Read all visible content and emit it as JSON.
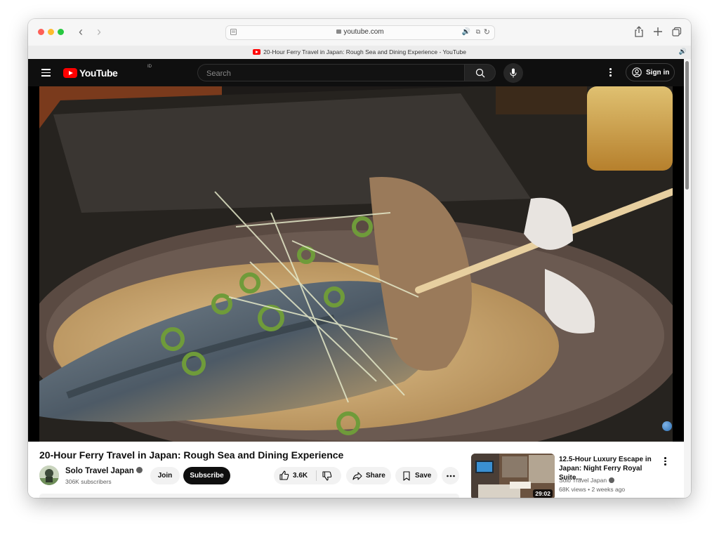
{
  "browser": {
    "url": "youtube.com",
    "tab_title": "20-Hour Ferry Travel in Japan: Rough Sea and Dining Experience - YouTube"
  },
  "masthead": {
    "logo_text": "YouTube",
    "country_code": "ID",
    "search_placeholder": "Search",
    "sign_in_label": "Sign in"
  },
  "video": {
    "title": "20-Hour Ferry Travel in Japan: Rough Sea and Dining Experience",
    "channel": "Solo Travel Japan",
    "subscribers": "306K subscribers",
    "join_label": "Join",
    "subscribe_label": "Subscribe",
    "likes": "3.6K",
    "share_label": "Share",
    "save_label": "Save"
  },
  "recommendation": {
    "title": "12.5-Hour Luxury Escape in Japan: Night Ferry Royal Suite...",
    "channel": "Solo Travel Japan",
    "meta": "68K views • 2 weeks ago",
    "duration": "29:02"
  },
  "colors": {
    "youtube_red": "#ff0000",
    "masthead_bg": "#0f0f0f",
    "subscribe_bg": "#0f0f0f"
  },
  "icons": [
    "back-icon",
    "forward-icon",
    "reader-icon",
    "lock-icon",
    "audio-icon",
    "translate-icon",
    "reload-icon",
    "share-icon",
    "new-tab-icon",
    "tabs-overview-icon",
    "menu-icon",
    "search-icon",
    "mic-icon",
    "more-icon",
    "account-icon",
    "like-icon",
    "dislike-icon",
    "verified-icon"
  ]
}
